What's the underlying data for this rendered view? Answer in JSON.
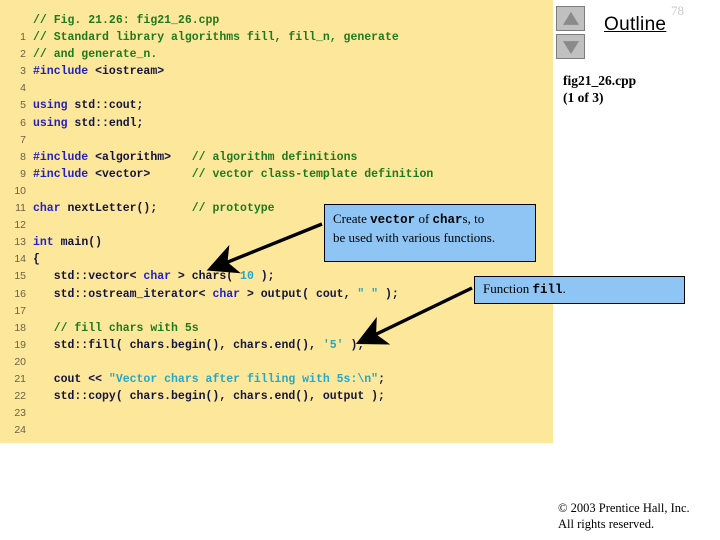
{
  "page": {
    "number": "78",
    "background": "#ffffff",
    "code_panel_color": "#fde79a"
  },
  "outline": {
    "title": "Outline",
    "file_name": "fig21_26.cpp",
    "part_label": "(1 of 3)",
    "nav_up_icon": "triangle-up-icon",
    "nav_down_icon": "triangle-down-icon"
  },
  "colors": {
    "comment": "#1f7a1f",
    "preprocessor": "#2222bb",
    "keyword": "#2222cc",
    "plain": "#12143c",
    "string": "#25a8c8",
    "line_number": "#6b6146",
    "callout_fill": "#8ec5f5",
    "panel": "#fde79a"
  },
  "code": {
    "line_numbers": [
      "1",
      "2",
      "3",
      "4",
      "5",
      "6",
      "7",
      "8",
      "9",
      "10",
      "11",
      "12",
      "13",
      "14",
      "15",
      "16",
      "17",
      "18",
      "19",
      "20",
      "21",
      "22",
      "23",
      "24"
    ],
    "lines": [
      {
        "n": "1",
        "text": "// Fig. 21.26: fig21_26.cpp"
      },
      {
        "n": "2",
        "text": "// Standard library algorithms fill, fill_n, generate"
      },
      {
        "n": "3",
        "text": "// and generate_n."
      },
      {
        "n": "4",
        "text": "#include <iostream>"
      },
      {
        "n": "5",
        "text": ""
      },
      {
        "n": "6",
        "text": "using std::cout;"
      },
      {
        "n": "7",
        "text": "using std::endl;"
      },
      {
        "n": "8",
        "text": ""
      },
      {
        "n": "9",
        "text": "#include <algorithm>   // algorithm definitions"
      },
      {
        "n": "10",
        "text": "#include <vector>      // vector class-template definition"
      },
      {
        "n": "11",
        "text": ""
      },
      {
        "n": "12",
        "text": "char nextLetter();     // prototype"
      },
      {
        "n": "13",
        "text": ""
      },
      {
        "n": "14",
        "text": "int main()"
      },
      {
        "n": "15",
        "text": "{"
      },
      {
        "n": "16",
        "text": "   std::vector< char > chars( 10 );"
      },
      {
        "n": "17",
        "text": "   std::ostream_iterator< char > output( cout, \" \" );"
      },
      {
        "n": "18",
        "text": ""
      },
      {
        "n": "19",
        "text": "   // fill chars with 5s"
      },
      {
        "n": "20",
        "text": "   std::fill( chars.begin(), chars.end(), '5' );"
      },
      {
        "n": "21",
        "text": ""
      },
      {
        "n": "22",
        "text": "   cout << \"Vector chars after filling with 5s:\\n\";"
      },
      {
        "n": "23",
        "text": "   std::copy( chars.begin(), chars.end(), output );"
      },
      {
        "n": "24",
        "text": ""
      }
    ]
  },
  "callouts": [
    {
      "id": "callout-vector",
      "text_plain": "Create vector of chars, to be used with various functions.",
      "seg1": "Create ",
      "seg2": "vector",
      "seg3": " of ",
      "seg4": "char",
      "seg5": "s, to",
      "seg6": "be used with various functions."
    },
    {
      "id": "callout-fill",
      "text_plain": "Function fill.",
      "seg1": "Function ",
      "seg2": "fill",
      "seg3": "."
    }
  ],
  "footer": {
    "copyright": "© 2003 Prentice Hall, Inc.",
    "rights": "All rights reserved."
  }
}
